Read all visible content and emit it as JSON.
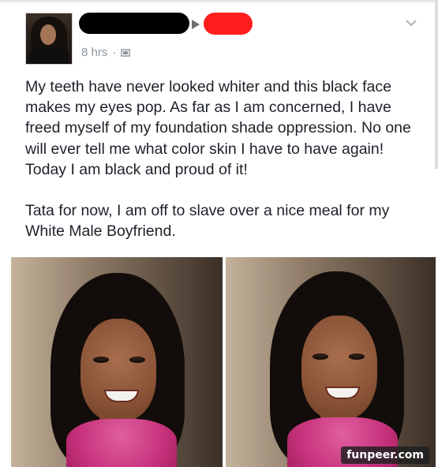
{
  "post": {
    "timestamp": "8 hrs",
    "privacy_icon": "public-icon",
    "menu_icon": "chevron-down-icon",
    "paragraphs": [
      "My teeth have never looked whiter and this black face makes my eyes pop. As far as I am concerned, I have freed myself of my foundation shade oppression. No one will ever tell me what color skin I have to have again! Today I am black and proud of it!",
      "Tata for now, I am off to slave over a nice meal for my White Male  Boyfriend."
    ]
  },
  "redactions": {
    "name_color": "#000000",
    "target_color": "#ff1e1e"
  },
  "watermark": "funpeer.com"
}
